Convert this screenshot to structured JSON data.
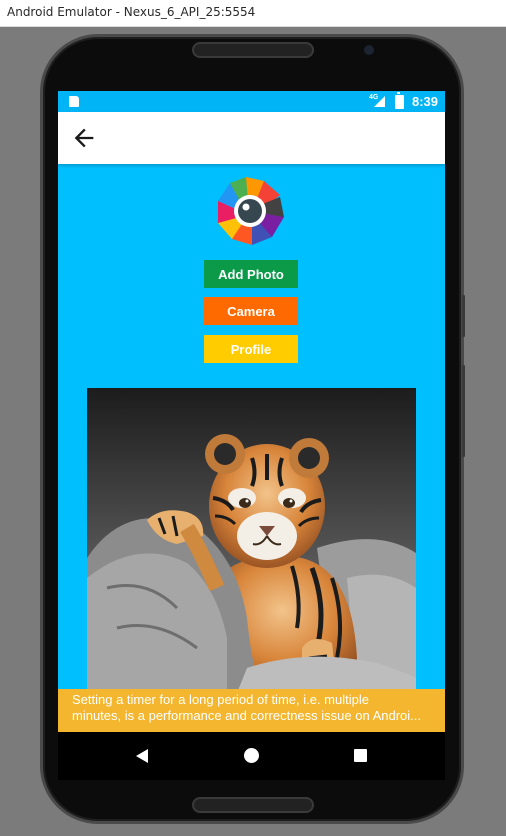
{
  "window": {
    "title": "Android Emulator - Nexus_6_API_25:5554"
  },
  "status_bar": {
    "time": "8:39",
    "network_type": "4G",
    "icons": [
      "sd-card-icon",
      "signal-icon",
      "battery-charging-icon"
    ]
  },
  "toolbar": {
    "back_icon": "arrow-back-icon"
  },
  "app": {
    "logo_icon": "camera-aperture-logo-icon",
    "buttons": {
      "add_photo": "Add Photo",
      "camera": "Camera",
      "profile": "Profile"
    },
    "colors": {
      "background": "#00bfff",
      "add_photo": "#0a9a48",
      "camera": "#ff6a00",
      "profile": "#ffcc00",
      "toast": "#f3b62e"
    },
    "image_subject": "tiger-cub-photo"
  },
  "toast": {
    "line1": "Setting a timer for a long period of time, i.e. multiple",
    "line2": "minutes, is a performance and correctness issue on Androi..."
  },
  "nav_bar": {
    "icons": [
      "back-icon",
      "home-icon",
      "recents-icon"
    ]
  }
}
